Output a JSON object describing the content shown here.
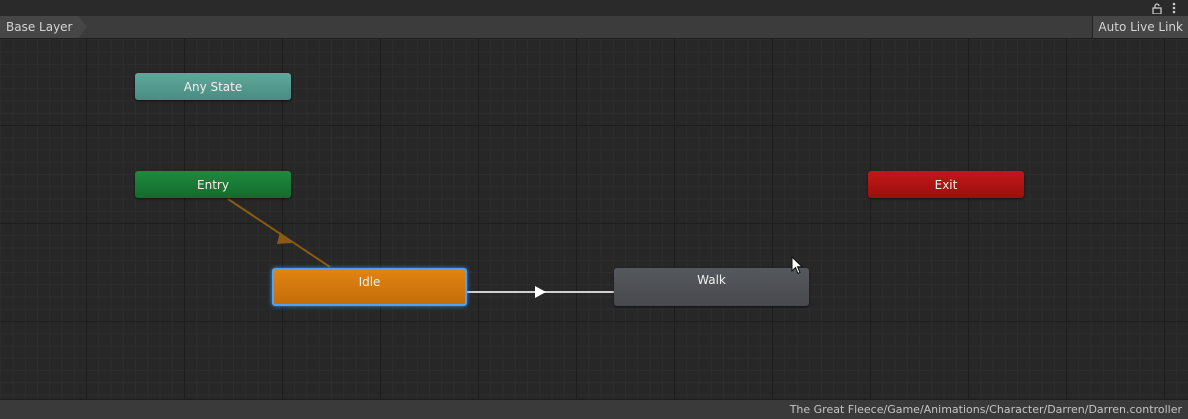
{
  "window": {
    "lock_icon": "lock-icon",
    "menu_icon": "kebab-menu-icon",
    "lock_glyph": "🔓",
    "menu_glyph": "⋮"
  },
  "toolbar": {
    "breadcrumb": "Base Layer",
    "auto_live_link": "Auto Live Link"
  },
  "graph": {
    "states": {
      "any_state": "Any State",
      "entry": "Entry",
      "exit": "Exit",
      "idle": "Idle",
      "walk": "Walk"
    },
    "colors": {
      "any_state": "#4f9a8e",
      "entry": "#197a36",
      "exit": "#b01313",
      "idle_default": "#d47a0e",
      "walk": "#4d5054",
      "selection": "#4aa3ff",
      "entry_transition": "#8a5a12",
      "transition": "#d0d0d0"
    },
    "selected_state": "Idle",
    "default_state": "Idle",
    "transitions": [
      {
        "from": "Entry",
        "to": "Idle"
      },
      {
        "from": "Idle",
        "to": "Walk"
      }
    ]
  },
  "status": {
    "path": "The Great Fleece/Game/Animations/Character/Darren/Darren.controller"
  }
}
